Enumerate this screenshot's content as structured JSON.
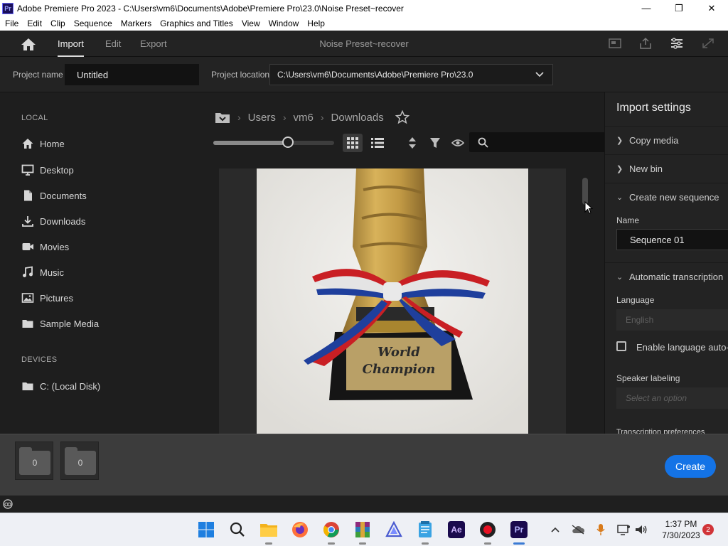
{
  "window": {
    "app_icon": "Pr",
    "title": "Adobe Premiere Pro 2023 - C:\\Users\\vm6\\Documents\\Adobe\\Premiere Pro\\23.0\\Noise Preset~recover",
    "minimize_icon": "minimize-icon",
    "maximize_icon": "maximize-icon",
    "close_icon": "close-icon"
  },
  "menu": [
    "File",
    "Edit",
    "Clip",
    "Sequence",
    "Markers",
    "Graphics and Titles",
    "View",
    "Window",
    "Help"
  ],
  "nav": {
    "tabs": [
      {
        "label": "Import",
        "active": true
      },
      {
        "label": "Edit",
        "active": false
      },
      {
        "label": "Export",
        "active": false
      }
    ],
    "document_title": "Noise Preset~recover"
  },
  "project": {
    "name_label": "Project name",
    "name_value": "Untitled",
    "location_label": "Project location",
    "location_value": "C:\\Users\\vm6\\Documents\\Adobe\\Premiere Pro\\23.0"
  },
  "sidebar": {
    "local_header": "LOCAL",
    "local_items": [
      {
        "label": "Home",
        "icon": "home-icon"
      },
      {
        "label": "Desktop",
        "icon": "desktop-icon"
      },
      {
        "label": "Documents",
        "icon": "document-icon"
      },
      {
        "label": "Downloads",
        "icon": "download-icon"
      },
      {
        "label": "Movies",
        "icon": "movie-icon"
      },
      {
        "label": "Music",
        "icon": "music-icon"
      },
      {
        "label": "Pictures",
        "icon": "pictures-icon"
      },
      {
        "label": "Sample Media",
        "icon": "folder-icon"
      }
    ],
    "devices_header": "DEVICES",
    "device_items": [
      {
        "label": "C: (Local Disk)",
        "icon": "folder-icon"
      }
    ]
  },
  "browser": {
    "breadcrumb": [
      "Users",
      "vm6",
      "Downloads"
    ],
    "thumbnail_zoom": 0.62,
    "thumbnail_plaque": [
      "World",
      "Champion"
    ]
  },
  "settings": {
    "title": "Import settings",
    "copy_media": "Copy media",
    "new_bin": "New bin",
    "create_sequence": "Create new sequence",
    "name_label": "Name",
    "name_value": "Sequence 01",
    "auto_transcription": "Automatic transcription",
    "language_label": "Language",
    "language_value": "English",
    "enable_language": "Enable language auto-d",
    "speaker_label": "Speaker labeling",
    "speaker_placeholder": "Select an option",
    "transcription_prefs": "Transcription preferences"
  },
  "tray": {
    "bins": [
      {
        "count": "0"
      },
      {
        "count": "0"
      }
    ],
    "create_label": "Create"
  },
  "taskbar": {
    "apps": [
      "windows-start-icon",
      "search-icon",
      "file-explorer-icon",
      "firefox-icon",
      "chrome-icon",
      "winrar-icon",
      "affinity-icon",
      "notepad-icon",
      "after-effects-icon",
      "recorder-icon",
      "premiere-pro-icon"
    ],
    "ae_label": "Ae",
    "pr_label": "Pr",
    "time": "1:37 PM",
    "date": "7/30/2023",
    "notification_count": "2"
  },
  "colors": {
    "accent": "#1473e6",
    "panel": "#232323",
    "background": "#1e1e1e"
  }
}
